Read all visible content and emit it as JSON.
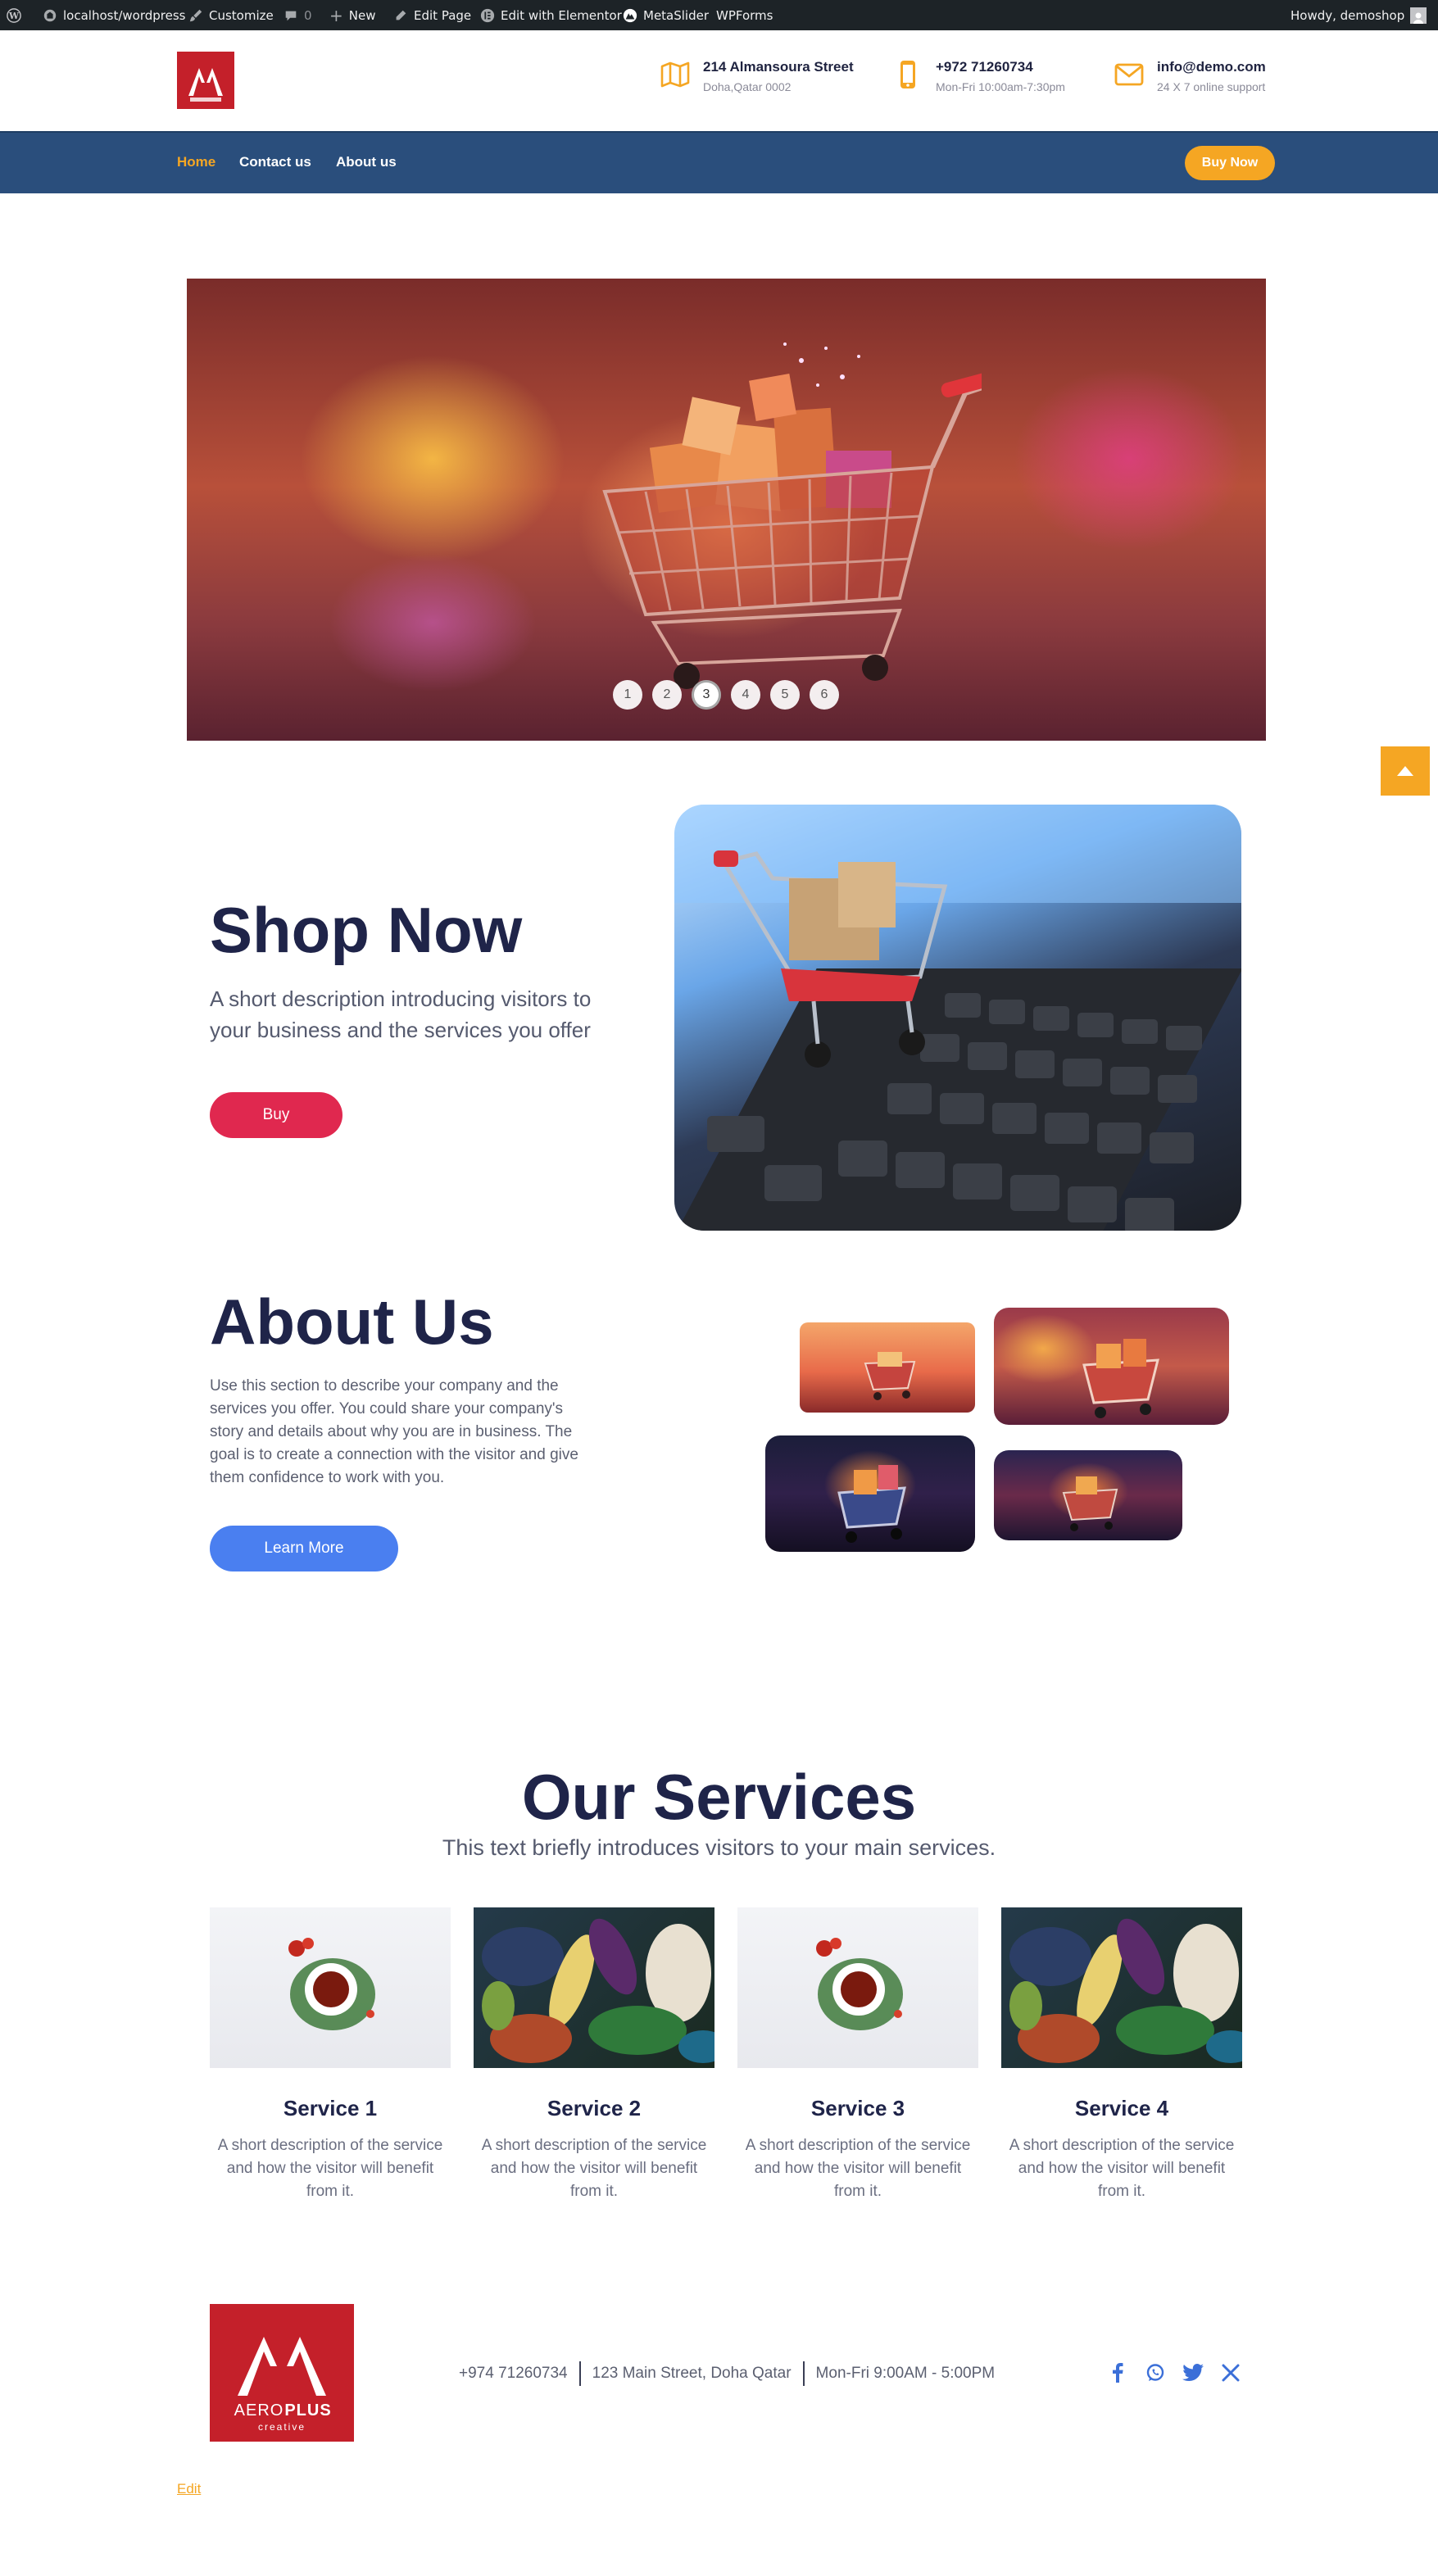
{
  "adminbar": {
    "site": "localhost/wordpress",
    "customize": "Customize",
    "comments": "0",
    "new": "New",
    "edit_page": "Edit Page",
    "elementor": "Edit with Elementor",
    "metaslider": "MetaSlider",
    "wpforms": "WPForms",
    "howdy": "Howdy, demoshop"
  },
  "header": {
    "address_title": "214 Almansoura Street",
    "address_sub": "Doha,Qatar 0002",
    "phone_title": "+972 71260734",
    "phone_sub": "Mon-Fri 10:00am-7:30pm",
    "email_title": "info@demo.com",
    "email_sub": "24 X 7 online support"
  },
  "nav": {
    "items": [
      {
        "label": "Home",
        "active": true
      },
      {
        "label": "Contact us",
        "active": false
      },
      {
        "label": "About us",
        "active": false
      }
    ],
    "buy_now": "Buy Now"
  },
  "slider": {
    "dots": [
      "1",
      "2",
      "3",
      "4",
      "5",
      "6"
    ],
    "active_dot": "3"
  },
  "shop": {
    "title": "Shop Now",
    "description": "A short description introducing visitors to your business and the services you offer",
    "button": "Buy"
  },
  "about": {
    "title": "About Us",
    "description": "Use this section to describe your company and the services you offer. You could share your company's story and details about why you are in business. The goal is to create a connection with the visitor and give them confidence to work with you.",
    "button": "Learn More"
  },
  "services": {
    "title": "Our Services",
    "subtitle": "This text briefly introduces visitors to your main services.",
    "items": [
      {
        "name": "Service 1",
        "text": "A short description of the service and how the visitor will benefit from it."
      },
      {
        "name": "Service 2",
        "text": "A short description of the service and how the visitor will benefit from it."
      },
      {
        "name": "Service 3",
        "text": "A short description of the service and how the visitor will benefit from it."
      },
      {
        "name": "Service 4",
        "text": "A short description of the service and how the visitor will benefit from it."
      }
    ]
  },
  "footer": {
    "phone": "+974 71260734",
    "address": "123 Main Street, Doha Qatar",
    "hours": "Mon-Fri 9:00AM - 5:00PM",
    "logo_text_left": "AERO",
    "logo_text_right": "PLUS",
    "logo_tagline": "creative",
    "edit": "Edit"
  },
  "colors": {
    "accent": "#f5a623",
    "nav_bg": "#2a4e7c",
    "brand_red": "#c4202a",
    "buy_button": "#e0284f",
    "learn_button": "#4a7ff0"
  }
}
